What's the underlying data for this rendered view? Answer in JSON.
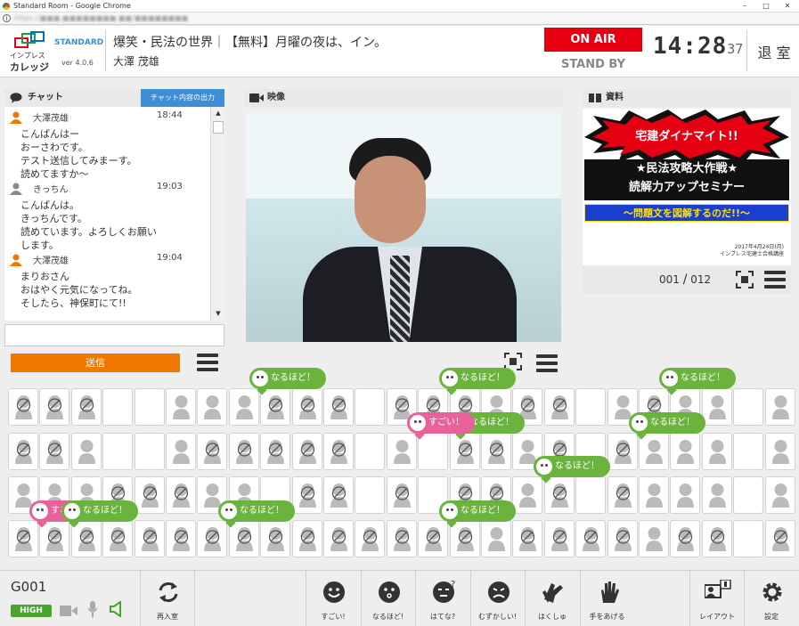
{
  "window": {
    "title": "Standard Room - Google Chrome",
    "url": "https://■■■.■■■■■■■■.■■/■■■■■■■■"
  },
  "header": {
    "logo_line1": "インプレス",
    "logo_line2": "カレッジ",
    "edition": "STANDARD",
    "version": "ver 4.0.6",
    "course_title": "爆笑・民法の世界｜【無料】月曜の夜は、イン。",
    "instructor": "大澤 茂雄",
    "on_air": "ON AIR",
    "stand_by": "STAND BY",
    "clock_hm": "14:28",
    "clock_s": "37",
    "exit_label": "退 室",
    "on_air_color": "#e60012"
  },
  "chat": {
    "header": "チャット",
    "export_label": "チャット内容の出力",
    "messages": [
      {
        "user": "大澤茂雄",
        "time": "18:44",
        "lines": [
          "こんばんはー",
          "おーさわです。",
          "テスト送信してみまーす。",
          "読めてますか〜"
        ]
      },
      {
        "user": "きっちん",
        "time": "19:03",
        "lines": [
          "こんばんは。",
          "きっちんです。",
          "読めています。よろしくお願い",
          "します。"
        ]
      },
      {
        "user": "大澤茂雄",
        "time": "19:04",
        "lines": [
          "まりおさん",
          "おはやく元気になってね。",
          "そしたら、神保町にて!!"
        ]
      }
    ],
    "input_value": "",
    "send_label": "送信"
  },
  "video": {
    "header": "映像"
  },
  "material": {
    "header": "資料",
    "banner": "宅建ダイナマイト!!",
    "title1": "★民法攻略大作戦★",
    "title2": "読解力アップセミナー",
    "subtitle": "〜問題文を図解するのだ!!〜",
    "date": "2017年4月24日(月)",
    "org": "インプレス宅建士合格講座",
    "page_current": "001",
    "page_sep": "/",
    "page_total": "012"
  },
  "reactions": {
    "naruhodo": "なるほど！",
    "sugoi": "すごい！"
  },
  "seats": {
    "rows": [
      "ddd.....ddd.ddd.dd..d....",
      "dd....ddddd...dd.d.d.....",
      "...ddd...dd.d.dd.d.d.....",
      "ddddddddddddddd.dddd.dd.d"
    ]
  },
  "bottom": {
    "user_id": "G001",
    "quality": "HIGH",
    "reenter": "再入室",
    "tools": [
      "すごい!",
      "なるほど!",
      "はてな?",
      "むずかしい!",
      "はくしゅ",
      "手をあげる"
    ],
    "layout": "レイアウト",
    "settings": "設定"
  }
}
